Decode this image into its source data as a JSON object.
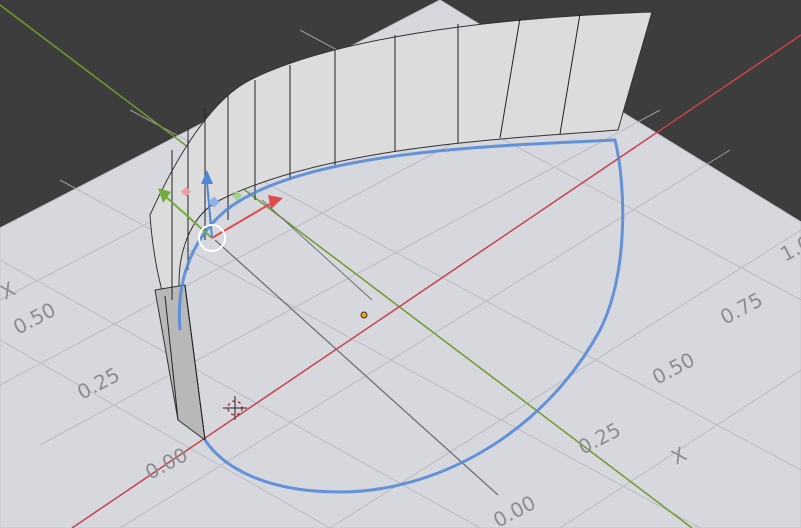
{
  "viewport": {
    "background_color": "#3d3d3d",
    "plane_color": "#d6d8dd",
    "plane_edge_color": "#c2c4c9",
    "grid_color": "#aeb0b6",
    "x_axis_color": "#c8424a",
    "y_axis_color": "#6f9a2c",
    "curve_color": "#4f86d8",
    "wall_fill_color": "#d9d9d9",
    "label_color": "#8b8d92"
  },
  "axis_labels": {
    "left_x": "X",
    "bottom_x": "X",
    "left_050": "0.50",
    "left_025": "0.25",
    "left_000": "0.00",
    "bottom_000": "0.00",
    "right_025": "0.25",
    "right_050": "0.50",
    "right_075": "0.75",
    "right_100": "1.0"
  },
  "gizmo": {
    "icons": [
      "move-arrow-x",
      "move-arrow-y",
      "move-arrow-z",
      "plane-handle-xy",
      "plane-handle-xz",
      "plane-handle-yz",
      "rotate-circle"
    ]
  },
  "cursor_3d": {
    "icon": "3d-cursor-icon"
  },
  "origin_marker": {
    "color": "#f0a020"
  }
}
